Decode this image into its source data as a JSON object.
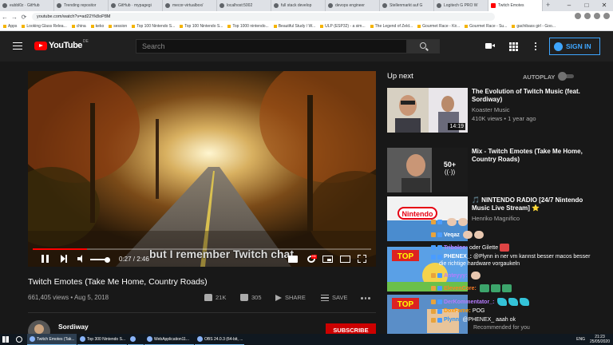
{
  "browser": {
    "tabs": [
      {
        "label": "eubbl0z · GitHub"
      },
      {
        "label": "Trending repositor"
      },
      {
        "label": "GitHub · mypagegi"
      },
      {
        "label": "mecor-virtualbox/"
      },
      {
        "label": "localhost:5002"
      },
      {
        "label": "full stack develop"
      },
      {
        "label": "devops engineer"
      },
      {
        "label": "Stellenmarkt auf G"
      },
      {
        "label": "Logitech G PRO W"
      },
      {
        "label": "Twitch Emotes"
      }
    ],
    "new_tab": "+",
    "url": "youtube.com/watch?v=ad22Yk8oP8M",
    "bookmarks": [
      "Apps",
      "Looking Glass Relea...",
      "china",
      "keko",
      "session",
      "Top 100 Nintendo S...",
      "Top 100 Nintendo S...",
      "Top 1000 nintendo...",
      "Beautiful Study / W...",
      "ULP (ESP32) - a sim...",
      "The Legend of Zeld...",
      "Gourmet Race - Kir...",
      "Gourmet Race - Su...",
      "gachibass girl - Goo..."
    ]
  },
  "header": {
    "logo_text": "YouTube",
    "country": "DE",
    "search_placeholder": "Search",
    "sign_in": "SIGN IN"
  },
  "player": {
    "caption": "but I remember Twitch chat",
    "time": "0:27 / 2:46",
    "progress_fraction": 0.16,
    "volume_fraction": 0.85
  },
  "video": {
    "title": "Twitch Emotes (Take Me Home, Country Roads)",
    "meta": "661,405 views • Aug 5, 2018",
    "likes": "21K",
    "dislikes": "305",
    "share": "SHARE",
    "save": "SAVE",
    "channel": "Sordiway",
    "subscribe": "SUBSCRIBE"
  },
  "sidebar": {
    "up_next": "Up next",
    "autoplay": "AUTOPLAY",
    "autoplay_on": false,
    "recs": [
      {
        "title": "The Evolution of Twitch Music (feat. Sordiway)",
        "channel": "Koaster Music",
        "meta": "410K views • 1 year ago",
        "duration": "14:19"
      },
      {
        "title": "Mix - Twitch Emotes (Take Me Home, Country Roads)",
        "overlay_count": "50+"
      },
      {
        "title": "🎵 NINTENDO RADIO [24/7 Nintendo Music Live Stream] ⭐",
        "channel": "Henriko Magnifico"
      }
    ]
  },
  "chat": [
    {
      "user": "",
      "msg": "",
      "user_color": "#ffffff"
    },
    {
      "user": "Veqaz",
      "msg": "",
      "user_color": "#ffffff"
    },
    {
      "user": "Tribolon:",
      "msg": "oder Gilette",
      "user_color": "#b57bff"
    },
    {
      "user": "PHENEX_:",
      "msg": "@Plynn in ner vm kannst besser macos besser",
      "user_color": "#ffffff"
    },
    {
      "user": "",
      "msg": "die richtige hardware vorgaukeln",
      "user_color": "#ffffff"
    },
    {
      "user": "Anteyyy:",
      "msg": "",
      "user_color": "#b57bff"
    },
    {
      "user": "ElevenCore:",
      "msg": "",
      "user_color": "#ff7f24"
    },
    {
      "user": "DerKommentator_:",
      "msg": "",
      "user_color": "#b57bff"
    },
    {
      "user": "DoxFame:",
      "msg": "POG",
      "user_color": "#ff9900"
    },
    {
      "user": "Plynn:",
      "msg": "@PHENEX_ aaah ok",
      "user_color": "#1e90ff"
    },
    {
      "user": "",
      "msg": "Recommended for you",
      "user_color": "#aaaaaa"
    }
  ],
  "taskbar": {
    "apps": [
      "Twitch Emotes (Tak...",
      "Top 300 Nintendo S...",
      "",
      "WebApplication11...",
      "OBS 24.0.3 (64-bit, ..."
    ],
    "lang": "ENG",
    "time": "21:23",
    "date": "25/05/2020"
  }
}
